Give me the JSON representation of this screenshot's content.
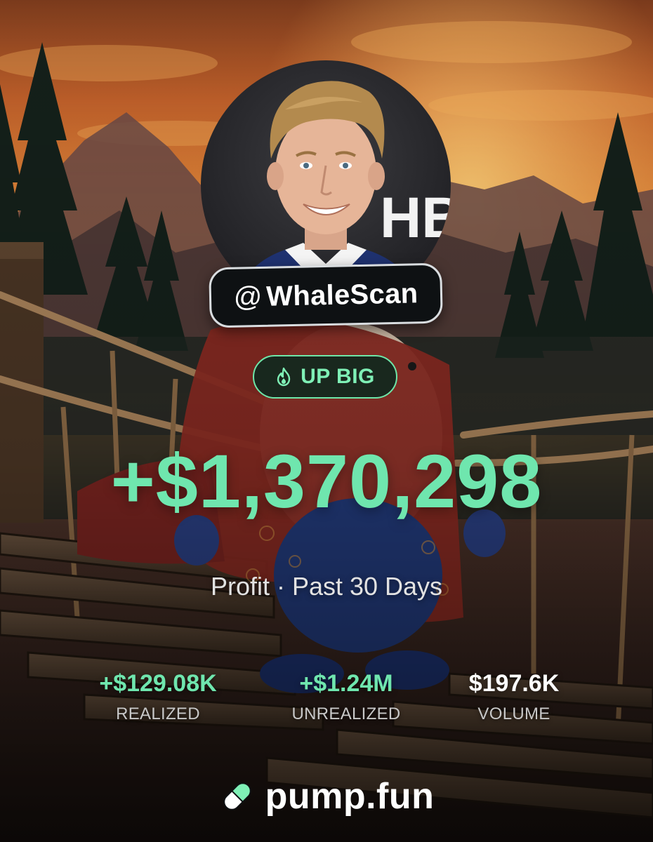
{
  "profile": {
    "handle_prefix": "@",
    "handle": "WhaleScan"
  },
  "badge": {
    "label": "UP BIG",
    "icon": "flame-icon",
    "color": "#7ff0b6"
  },
  "summary": {
    "profit": "+$1,370,298",
    "caption": "Profit · Past 30 Days",
    "accent_color": "#6fe6ae"
  },
  "stats": [
    {
      "value": "+$129.08K",
      "label": "REALIZED"
    },
    {
      "value": "+$1.24M",
      "label": "UNREALIZED"
    },
    {
      "value": "$197.6K",
      "label": "VOLUME"
    }
  ],
  "brand": {
    "name": "pump.fun",
    "icon": "pill-logo-icon",
    "avatar_text": "HB"
  }
}
